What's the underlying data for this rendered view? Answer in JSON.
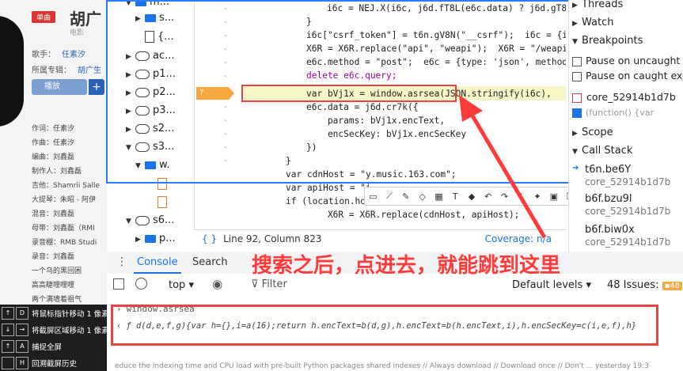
{
  "music_page": {
    "badge": "单曲",
    "title": "胡广",
    "subtitle": "电影",
    "singer_label": "歌手：",
    "singer_value": "任素汐",
    "album_label": "所属专辑：",
    "album_value": "胡广生",
    "play_label": "播放",
    "plus_label": "+",
    "credits": [
      "作词：任素汐",
      "作曲：任素汐",
      "编曲：刘鑫磊",
      "制作人：刘鑫磊",
      "吉他：Shamrii Salle",
      "大提琴：朱昭 - 阿伊",
      "混音：刘鑫磊",
      "母带：刘鑫磊（RMI",
      "录音棚：RMB Studi",
      "录音：刘鑫磊",
      "一个乌的黑回困",
      "高高睫哩哩哩",
      "两个满墙着祖气"
    ]
  },
  "shortcuts": [
    {
      "keys": [
        "↑",
        "D"
      ],
      "label": "将鼠标指针移动 1 像素"
    },
    {
      "keys": [
        "↓",
        "→"
      ],
      "label": "将截屏区域移动 1 像素"
    },
    {
      "keys": [
        "↑",
        "A"
      ],
      "label": "捕捉全屏"
    },
    {
      "keys": [
        "",
        "H"
      ],
      "label": "回溯截屏历史"
    }
  ],
  "file_tree": {
    "items": [
      {
        "label": "m...",
        "kind": "folder",
        "expanded": true
      },
      {
        "label": "s...",
        "kind": "folder",
        "expanded": false
      },
      {
        "label": "{...",
        "kind": "file"
      },
      {
        "label": "ac...",
        "kind": "cloud",
        "expanded": false
      },
      {
        "label": "p1...",
        "kind": "cloud",
        "expanded": false
      },
      {
        "label": "p2...",
        "kind": "cloud",
        "expanded": false
      },
      {
        "label": "p3...",
        "kind": "cloud",
        "expanded": false
      },
      {
        "label": "s2...",
        "kind": "cloud",
        "expanded": false
      },
      {
        "label": "s3...",
        "kind": "cloud",
        "expanded": true
      },
      {
        "label": "w.",
        "kind": "folder",
        "expanded": true
      },
      {
        "label": "",
        "kind": "file-orange"
      },
      {
        "label": "",
        "kind": "file-orange"
      },
      {
        "label": "s6...",
        "kind": "cloud",
        "expanded": true
      },
      {
        "label": "p...",
        "kind": "folder",
        "expanded": false
      }
    ]
  },
  "code": {
    "lines": [
      "i6c = NEJ.X(i6c, j6d.fT8L(e6c.data) ? j6d.gT8L",
      "}",
      "i6c[\"csrf_token\"] = t6n.gV8N(\"__csrf\");  i6c = {ic",
      "X6R = X6R.replace(\"api\", \"weapi\");  X6R = \"/weapi/",
      "e6c.method = \"post\";  e6c = {type: 'json', method:",
      "delete e6c.query;",
      "var bVj1x = window.asrsea(JSON.stringify(i6c),",
      "e6c.data = j6d.cr7k({",
      "    params: bVj1x.encText,",
      "    encSecKey: bVj1x.encSecKey",
      "})",
      "}",
      "var cdnHost = \"y.music.163.com\";",
      "var apiHost = \"i",
      "if (location.host === cdnHost) {",
      "    X6R = X6R.replace(cdnHost, apiHost);"
    ],
    "breakpoint_marker": "?",
    "gutter_dashes": [
      "-",
      "-",
      "-",
      "-",
      "-",
      "-",
      "-",
      "-",
      "-",
      "-",
      "-"
    ]
  },
  "draw_toolbar_icons": [
    "rect-icon",
    "line-icon",
    "pen-icon",
    "marker-icon",
    "mosaic-icon",
    "text-icon",
    "eraser-icon",
    "undo-icon",
    "redo-icon",
    "more-icon",
    "pin-icon",
    "save-icon",
    "copy-icon"
  ],
  "status_bar": {
    "position": "Line 92, Column 823",
    "coverage": "Coverage: n/a",
    "braces": "{ }"
  },
  "right_panel": {
    "threads": "Threads",
    "watch": "Watch",
    "breakpoints": "Breakpoints",
    "pause_uncaught": "Pause on uncaught",
    "pause_caught": "Pause on caught exc",
    "bp_file": "core_52914b1d7b",
    "bp_code": "(function() {var",
    "scope": "Scope",
    "call_stack": "Call Stack",
    "frames": [
      {
        "name": "t6n.be6Y",
        "file": "core_52914b1d7b"
      },
      {
        "name": "b6f.bzu9l",
        "file": "core_52914b1d7b"
      },
      {
        "name": "b6f.biw0x",
        "file": "core_52914b1d7b"
      }
    ]
  },
  "tabs": {
    "console": "Console",
    "search": "Search"
  },
  "console_bar": {
    "context": "top",
    "filter_placeholder": "Filter",
    "levels": "Default levels",
    "issues": "48 Issues:",
    "issues_count": "48"
  },
  "console": {
    "input": "window.asrsea",
    "output": "ƒ d(d,e,f,g){var h={},i=a(16);return h.encText=b(d,g),h.encText=b(h.encText,i),h.encSecKey=c(i,e,f),h}"
  },
  "annotation": "搜索之后，点进去，就能跳到这里",
  "bottom_text": "educe the indexing time and CPU load with pre-built Python packages shared indexes // Always download // Download once // Don't ... yesterday 19:3"
}
